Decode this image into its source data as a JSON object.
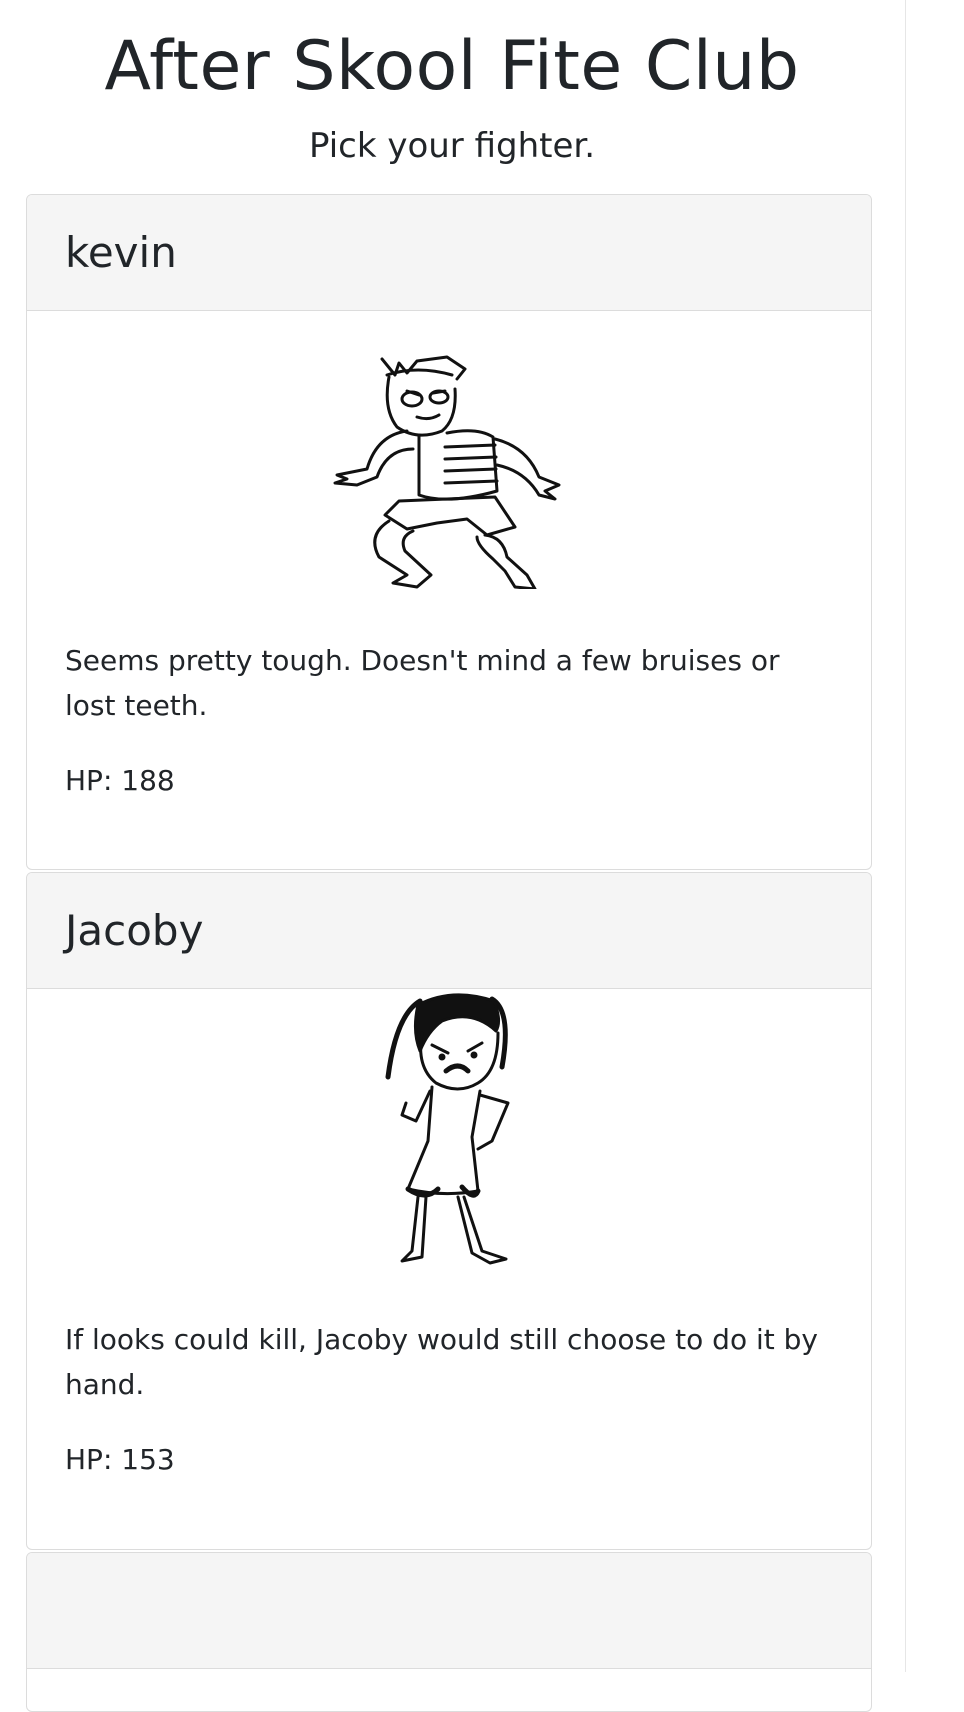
{
  "header": {
    "title": "After Skool Fite Club",
    "subtitle": "Pick your fighter."
  },
  "fighters": [
    {
      "name": "kevin",
      "icon": "kevin-drawing-icon",
      "description": "Seems pretty tough. Doesn't mind a few bruises or lost teeth.",
      "hp_text": "HP: 188"
    },
    {
      "name": "Jacoby",
      "icon": "jacoby-drawing-icon",
      "description": "If looks could kill, Jacoby would still choose to do it by hand.",
      "hp_text": "HP: 153"
    }
  ]
}
